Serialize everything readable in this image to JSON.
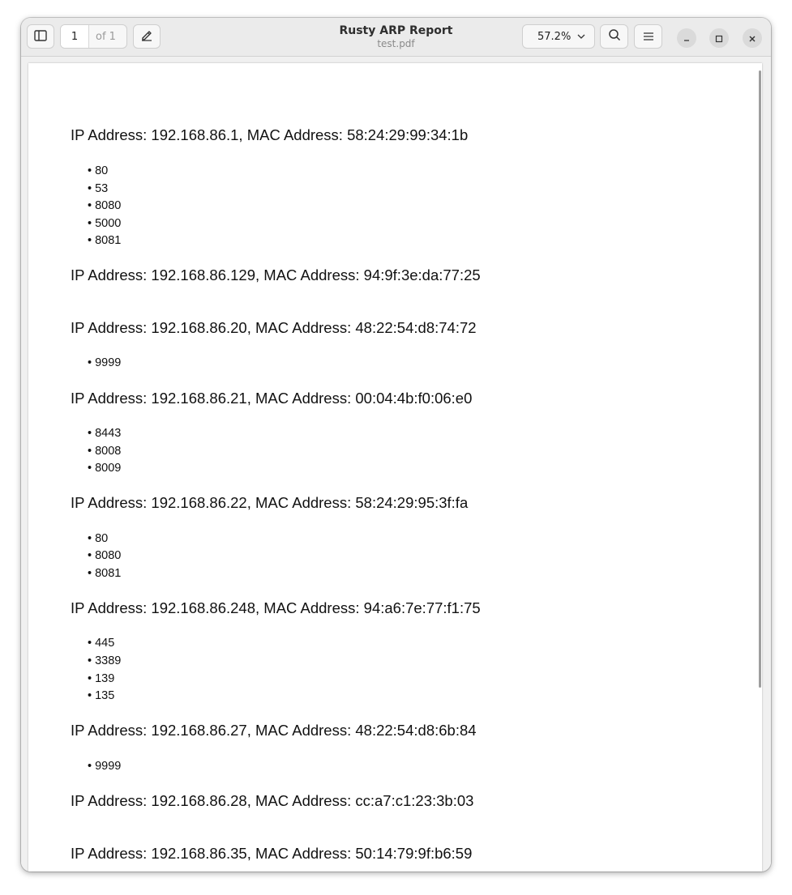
{
  "toolbar": {
    "page_current": "1",
    "page_total": "of 1",
    "zoom": "57.2%"
  },
  "window": {
    "title": "Rusty ARP Report",
    "subtitle": "test.pdf"
  },
  "report": {
    "hosts": [
      {
        "label": "IP Address: 192.168.86.1, MAC Address: 58:24:29:99:34:1b",
        "ports": [
          "80",
          "53",
          "8080",
          "5000",
          "8081"
        ]
      },
      {
        "label": "IP Address: 192.168.86.129, MAC Address: 94:9f:3e:da:77:25",
        "ports": []
      },
      {
        "label": "IP Address: 192.168.86.20, MAC Address: 48:22:54:d8:74:72",
        "ports": [
          "9999"
        ]
      },
      {
        "label": "IP Address: 192.168.86.21, MAC Address: 00:04:4b:f0:06:e0",
        "ports": [
          "8443",
          "8008",
          "8009"
        ]
      },
      {
        "label": "IP Address: 192.168.86.22, MAC Address: 58:24:29:95:3f:fa",
        "ports": [
          "80",
          "8080",
          "8081"
        ]
      },
      {
        "label": "IP Address: 192.168.86.248, MAC Address: 94:a6:7e:77:f1:75",
        "ports": [
          "445",
          "3389",
          "139",
          "135"
        ]
      },
      {
        "label": "IP Address: 192.168.86.27, MAC Address: 48:22:54:d8:6b:84",
        "ports": [
          "9999"
        ]
      },
      {
        "label": "IP Address: 192.168.86.28, MAC Address: cc:a7:c1:23:3b:03",
        "ports": []
      },
      {
        "label": "IP Address: 192.168.86.35, MAC Address: 50:14:79:9f:b6:59",
        "ports": []
      }
    ]
  }
}
